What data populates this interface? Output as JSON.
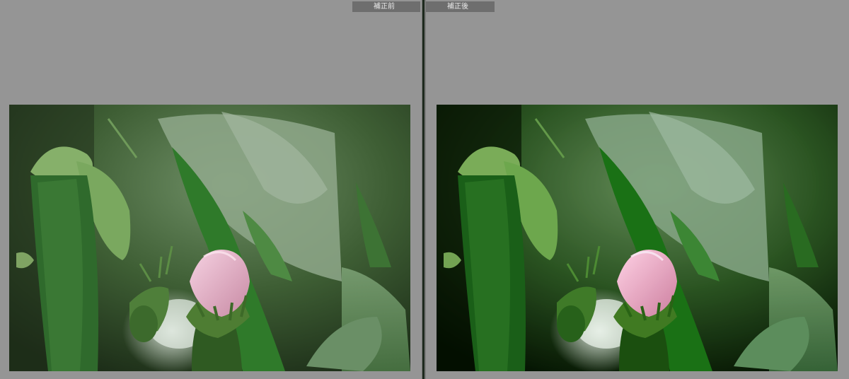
{
  "compare_view": {
    "before_label": "補正前",
    "after_label": "補正後"
  }
}
